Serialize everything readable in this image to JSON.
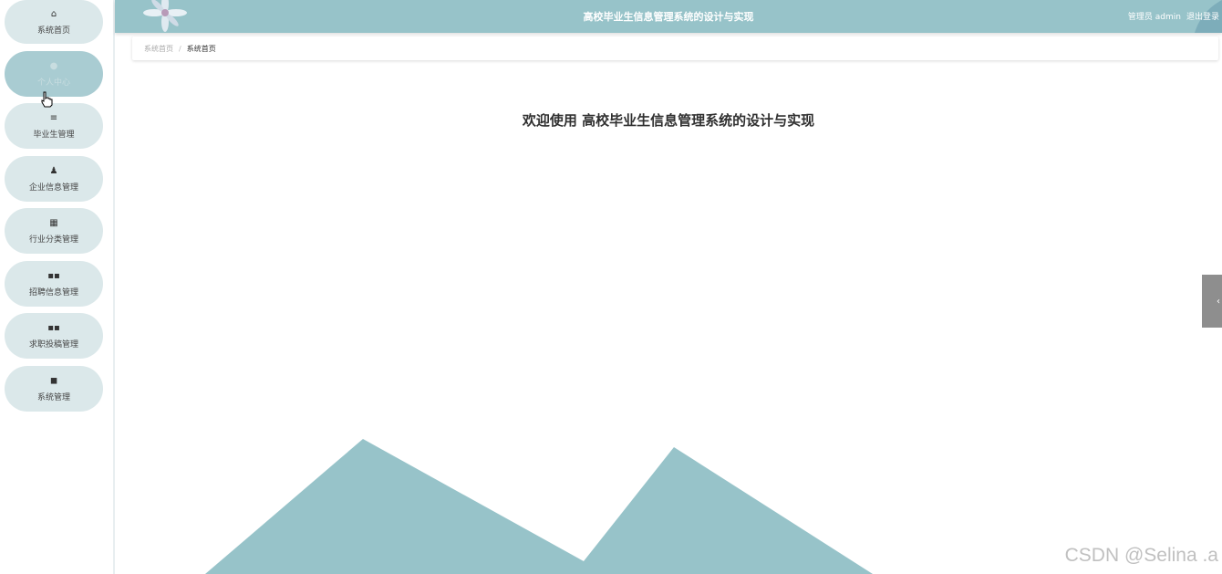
{
  "sidebar": {
    "items": [
      {
        "icon": "home-icon",
        "glyph": "⌂",
        "label": "系统首页"
      },
      {
        "icon": "person-icon",
        "glyph": "👤",
        "label": "个人中心"
      },
      {
        "icon": "list-icon",
        "glyph": "≡",
        "label": "毕业生管理"
      },
      {
        "icon": "user-icon",
        "glyph": "👤",
        "label": "企业信息管理"
      },
      {
        "icon": "grid-icon",
        "glyph": "⠿",
        "label": "行业分类管理"
      },
      {
        "icon": "apps-icon",
        "glyph": "▪▪",
        "label": "招聘信息管理"
      },
      {
        "icon": "apps-icon",
        "glyph": "▪▪",
        "label": "求职投稿管理"
      },
      {
        "icon": "chart-icon",
        "glyph": "◼",
        "label": "系统管理"
      }
    ]
  },
  "header": {
    "title": "高校毕业生信息管理系统的设计与实现",
    "user_label": "管理员 admin",
    "logout_label": "退出登录"
  },
  "breadcrumb": {
    "home": "系统首页",
    "separator": "/",
    "current": "系统首页"
  },
  "main": {
    "welcome": "欢迎使用 高校毕业生信息管理系统的设计与实现"
  },
  "watermark": "CSDN @Selina .a",
  "colors": {
    "accent": "#97c3c9",
    "nav_item_bg": "#dbe8ea",
    "nav_item_active_bg": "#a9ccd2"
  }
}
